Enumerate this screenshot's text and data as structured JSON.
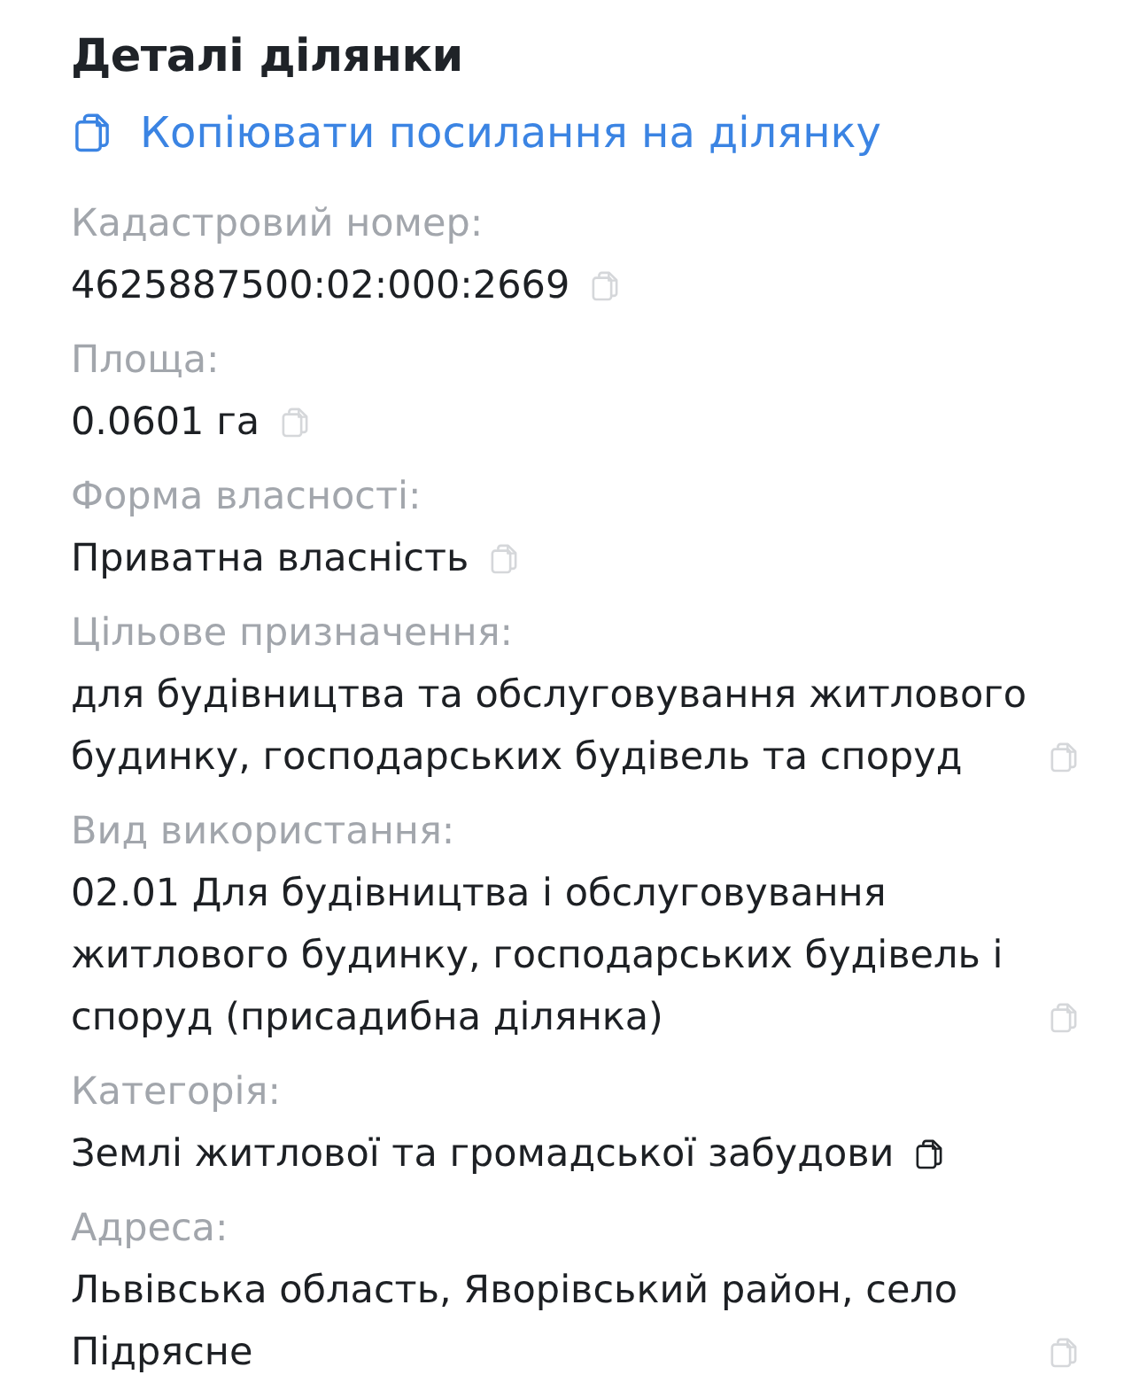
{
  "title": "Деталі ділянки",
  "copy_link": {
    "label": "Копіювати посилання на ділянку"
  },
  "fields": [
    {
      "label": "Кадастровий номер:",
      "value": "4625887500:02:000:2669",
      "copy_active": false
    },
    {
      "label": "Площа:",
      "value": "0.0601 га",
      "copy_active": false
    },
    {
      "label": "Форма власності:",
      "value": "Приватна власність",
      "copy_active": false
    },
    {
      "label": "Цільове призначення:",
      "value": "для будівництва та обслуговування житлового будинку, господарських будівель та споруд",
      "copy_active": false
    },
    {
      "label": "Вид використання:",
      "value": "02.01 Для будівництва і обслуговування житлового будинку, господарських будівель і споруд (присадибна ділянка)",
      "copy_active": false
    },
    {
      "label": "Категорія:",
      "value": "Землі житлової та громадської забудови",
      "copy_active": true
    },
    {
      "label": "Адреса:",
      "value": "Львівська область, Яворівський район, село Підрясне",
      "copy_active": false
    }
  ]
}
